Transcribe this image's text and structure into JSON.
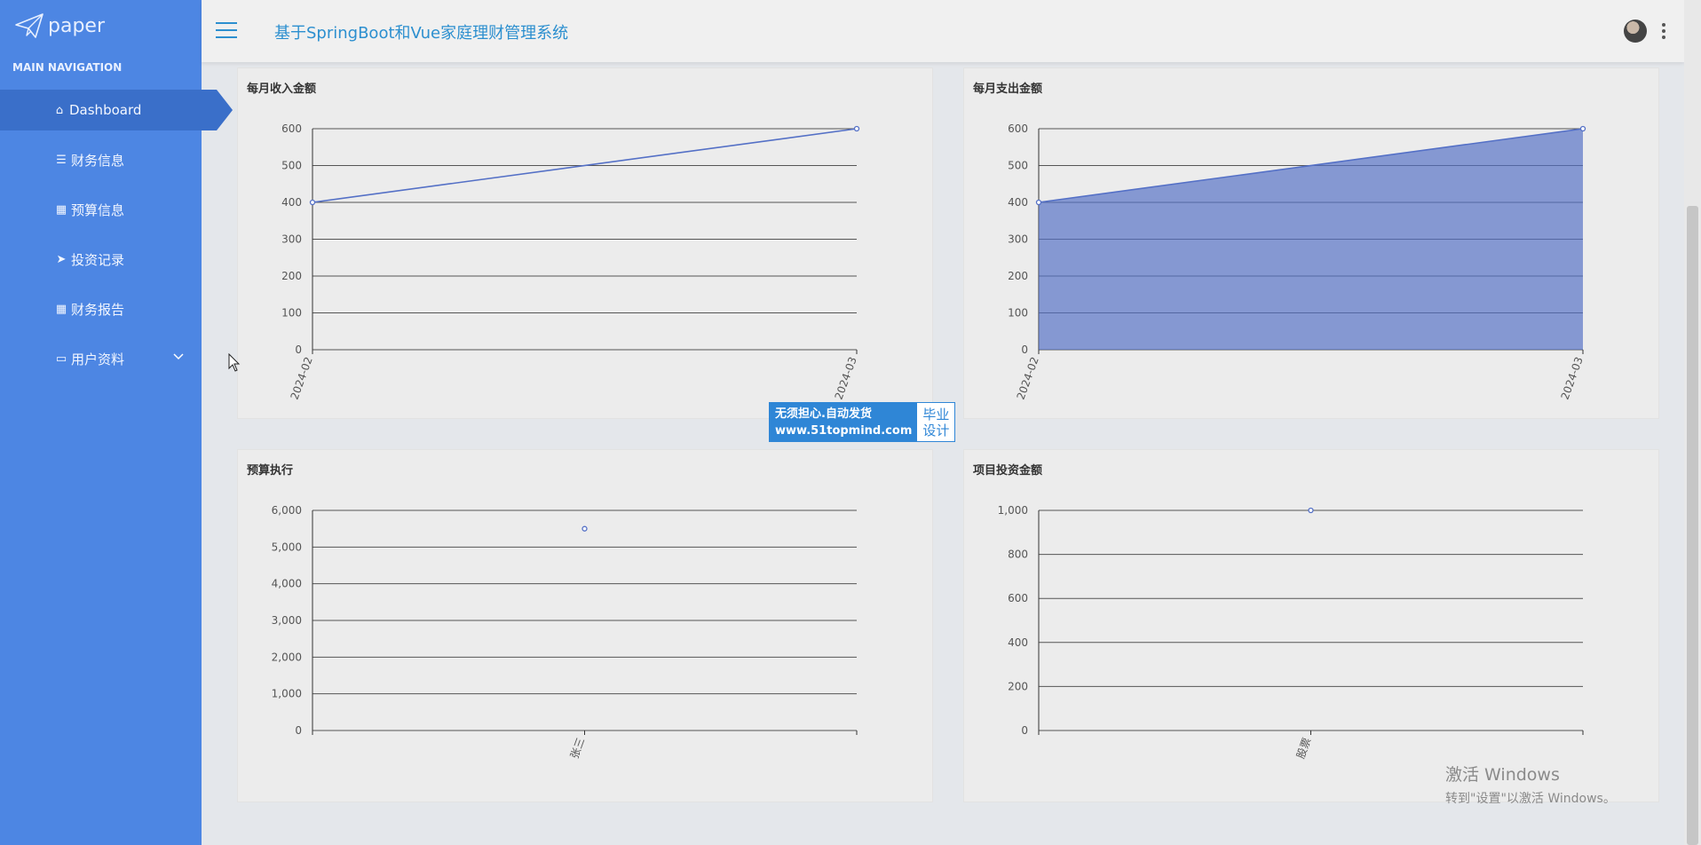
{
  "sidebar": {
    "logo_text": "paper",
    "heading": "MAIN NAVIGATION",
    "items": [
      {
        "label": "Dashboard",
        "icon": "home-icon",
        "active": true
      },
      {
        "label": "财务信息",
        "icon": "sliders-icon"
      },
      {
        "label": "预算信息",
        "icon": "grid-icon"
      },
      {
        "label": "投资记录",
        "icon": "send-icon"
      },
      {
        "label": "财务报告",
        "icon": "grid-icon"
      },
      {
        "label": "用户资料",
        "icon": "card-icon",
        "has_submenu": true
      }
    ]
  },
  "header": {
    "title": "基于SpringBoot和Vue家庭理财管理系统"
  },
  "panels": {
    "income": {
      "title": "每月收入金额"
    },
    "expense": {
      "title": "每月支出金额"
    },
    "budget": {
      "title": "预算执行"
    },
    "investment": {
      "title": "项目投资金额"
    }
  },
  "badge": {
    "line1": "无须担心.自动发货",
    "line2": "www.51topmind.com",
    "right1": "毕业",
    "right2": "设计"
  },
  "windows_activation": {
    "title": "激活 Windows",
    "subtitle": "转到\"设置\"以激活 Windows。"
  },
  "colors": {
    "sidebar": "#4d86e3",
    "accent": "#2c8fcf",
    "series": "#5470c6"
  },
  "chart_data": [
    {
      "type": "line",
      "title": "每月收入金额",
      "categories": [
        "2024-02",
        "2024-03"
      ],
      "values": [
        400,
        600
      ],
      "ylim": [
        0,
        600
      ],
      "yticks": [
        0,
        100,
        200,
        300,
        400,
        500,
        600
      ],
      "ytick_labels": [
        "0",
        "100",
        "200",
        "300",
        "400",
        "500",
        "600"
      ],
      "grid": true
    },
    {
      "type": "area",
      "title": "每月支出金额",
      "categories": [
        "2024-02",
        "2024-03"
      ],
      "values": [
        400,
        600
      ],
      "ylim": [
        0,
        600
      ],
      "yticks": [
        0,
        100,
        200,
        300,
        400,
        500,
        600
      ],
      "ytick_labels": [
        "0",
        "100",
        "200",
        "300",
        "400",
        "500",
        "600"
      ],
      "grid": true
    },
    {
      "type": "line",
      "title": "预算执行",
      "categories": [
        "张三"
      ],
      "values": [
        5500
      ],
      "ylim": [
        0,
        6000
      ],
      "yticks": [
        0,
        1000,
        2000,
        3000,
        4000,
        5000,
        6000
      ],
      "ytick_labels": [
        "0",
        "1,000",
        "2,000",
        "3,000",
        "4,000",
        "5,000",
        "6,000"
      ],
      "grid": true
    },
    {
      "type": "line",
      "title": "项目投资金额",
      "categories": [
        "股票"
      ],
      "values": [
        1000
      ],
      "ylim": [
        0,
        1000
      ],
      "yticks": [
        0,
        200,
        400,
        600,
        800,
        1000
      ],
      "ytick_labels": [
        "0",
        "200",
        "400",
        "600",
        "800",
        "1,000"
      ],
      "grid": true
    }
  ]
}
